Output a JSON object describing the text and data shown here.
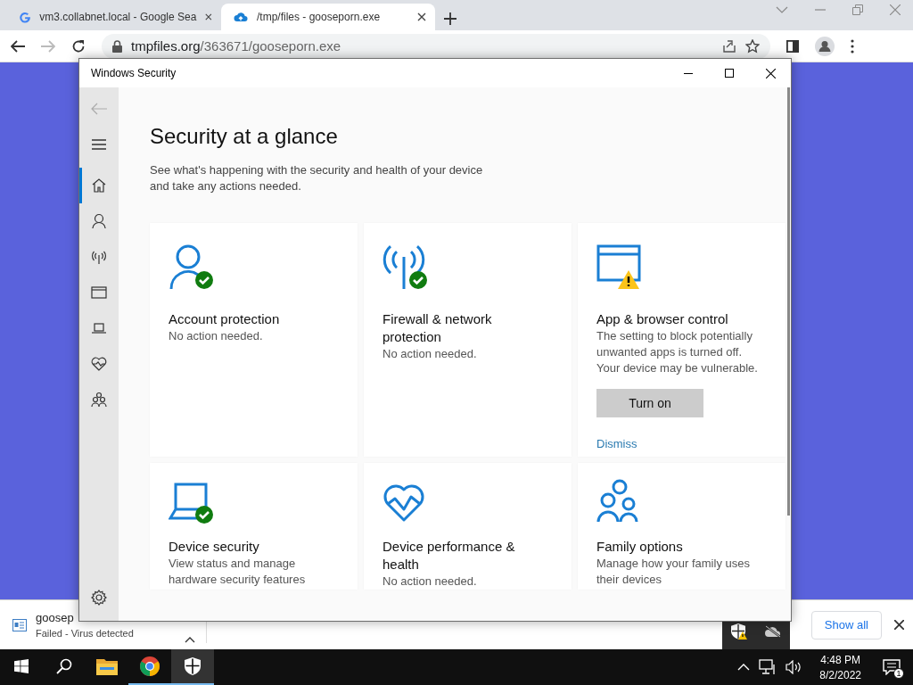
{
  "browser": {
    "tabs": [
      {
        "title": "vm3.collabnet.local - Google Sea",
        "kind": "google",
        "selected": false
      },
      {
        "title": "/tmp/files - gooseporn.exe",
        "kind": "cloud",
        "selected": true
      }
    ],
    "address": {
      "host": "tmpfiles.org",
      "path": "/363671/gooseporn.exe"
    },
    "forward_disabled": true
  },
  "download_bar": {
    "file_name": "goosep",
    "status": "Failed - Virus detected",
    "button": "Show all"
  },
  "security_window": {
    "title": "Windows Security",
    "heading": "Security at a glance",
    "description": "See what's happening with the security and health of your device and take any actions needed.",
    "nav": [
      {
        "kind": "home",
        "selected": true
      },
      {
        "kind": "account",
        "selected": false
      },
      {
        "kind": "firewall",
        "selected": false
      },
      {
        "kind": "browser",
        "selected": false
      },
      {
        "kind": "device",
        "selected": false
      },
      {
        "kind": "health",
        "selected": false
      },
      {
        "kind": "family",
        "selected": false
      }
    ],
    "cards": [
      {
        "kind": "account",
        "ok": true,
        "warning": false,
        "title": "Account protection",
        "lines": [
          "No action needed."
        ]
      },
      {
        "kind": "firewall",
        "ok": true,
        "warning": false,
        "title": "Firewall & network protection",
        "lines": [
          "No action needed."
        ]
      },
      {
        "kind": "browser",
        "ok": false,
        "warning": true,
        "title": "App & browser control",
        "lines": [
          "The setting to block potentially unwanted apps is turned off. Your device may be vulnerable."
        ],
        "button": "Turn on",
        "link": "Dismiss"
      },
      {
        "kind": "device",
        "ok": true,
        "warning": false,
        "title": "Device security",
        "lines": [
          "View status and manage",
          "hardware security features"
        ]
      },
      {
        "kind": "health",
        "ok": false,
        "warning": false,
        "title": "Device performance & health",
        "lines": [
          "No action needed."
        ]
      },
      {
        "kind": "family",
        "ok": false,
        "warning": false,
        "title": "Family options",
        "lines": [
          "Manage how your family uses",
          "their devices"
        ]
      }
    ]
  },
  "taskbar": {
    "apps": [
      {
        "kind": "explorer",
        "running": false,
        "selected": false
      },
      {
        "kind": "chrome",
        "running": true,
        "selected": false
      },
      {
        "kind": "security",
        "running": true,
        "selected": true
      }
    ],
    "time": "4:48 PM",
    "date": "8/2/2022",
    "notifications": "1"
  }
}
